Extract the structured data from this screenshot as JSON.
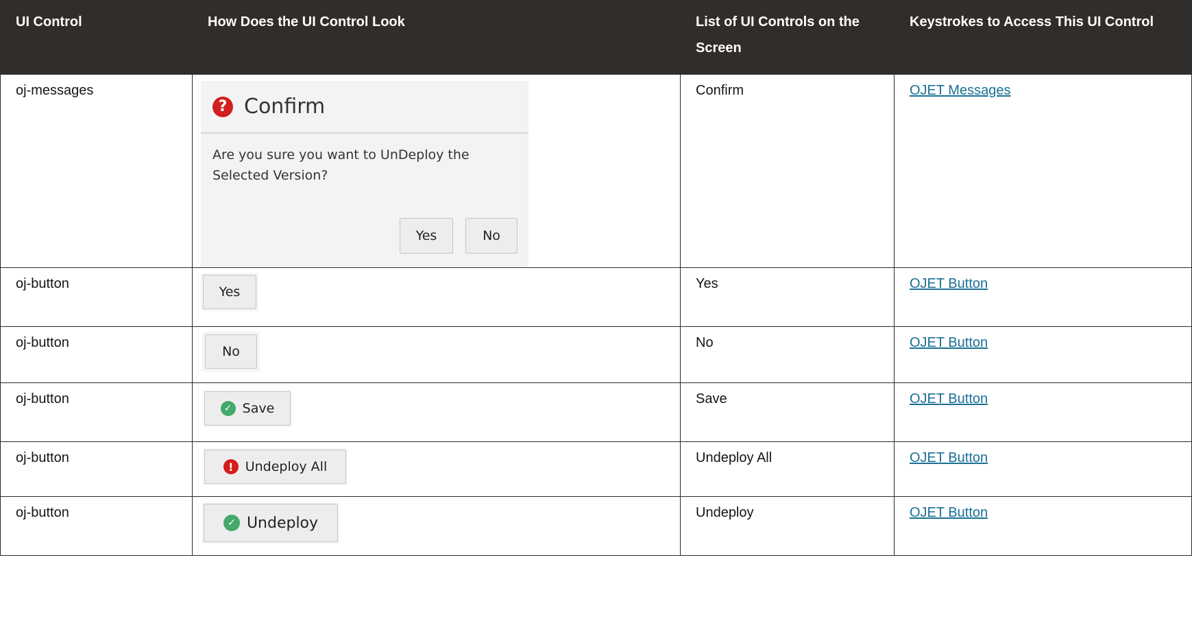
{
  "header": {
    "col1": "UI Control",
    "col2": "How Does the UI Control Look",
    "col3": "List of UI Controls on the Screen",
    "col4": "Keystrokes to Access This UI Control"
  },
  "rows": [
    {
      "control": "oj-messages",
      "look": {
        "dialog_title": "Confirm",
        "icon": "question-icon",
        "message": "Are you sure you want to UnDeploy the Selected Version?",
        "yes_label": "Yes",
        "no_label": "No"
      },
      "list": "Confirm",
      "link": "OJET Messages"
    },
    {
      "control": "oj-button",
      "look": {
        "label": "Yes"
      },
      "list": "Yes",
      "link": "OJET Button"
    },
    {
      "control": "oj-button",
      "look": {
        "label": "No"
      },
      "list": "No",
      "link": "OJET Button"
    },
    {
      "control": "oj-button",
      "look": {
        "label": "Save",
        "icon": "check-circle-icon"
      },
      "list": "Save",
      "link": "OJET Button"
    },
    {
      "control": "oj-button",
      "look": {
        "label": "Undeploy All",
        "icon": "error-circle-icon"
      },
      "list": "Undeploy All",
      "link": "OJET Button"
    },
    {
      "control": "oj-button",
      "look": {
        "label": "Undeploy",
        "icon": "check-circle-icon"
      },
      "list": "Undeploy",
      "link": "OJET Button"
    }
  ],
  "colors": {
    "header_bg": "#312d2a",
    "link": "#1a6f93",
    "success_icon": "#43a86a",
    "error_icon": "#d81a1a"
  }
}
